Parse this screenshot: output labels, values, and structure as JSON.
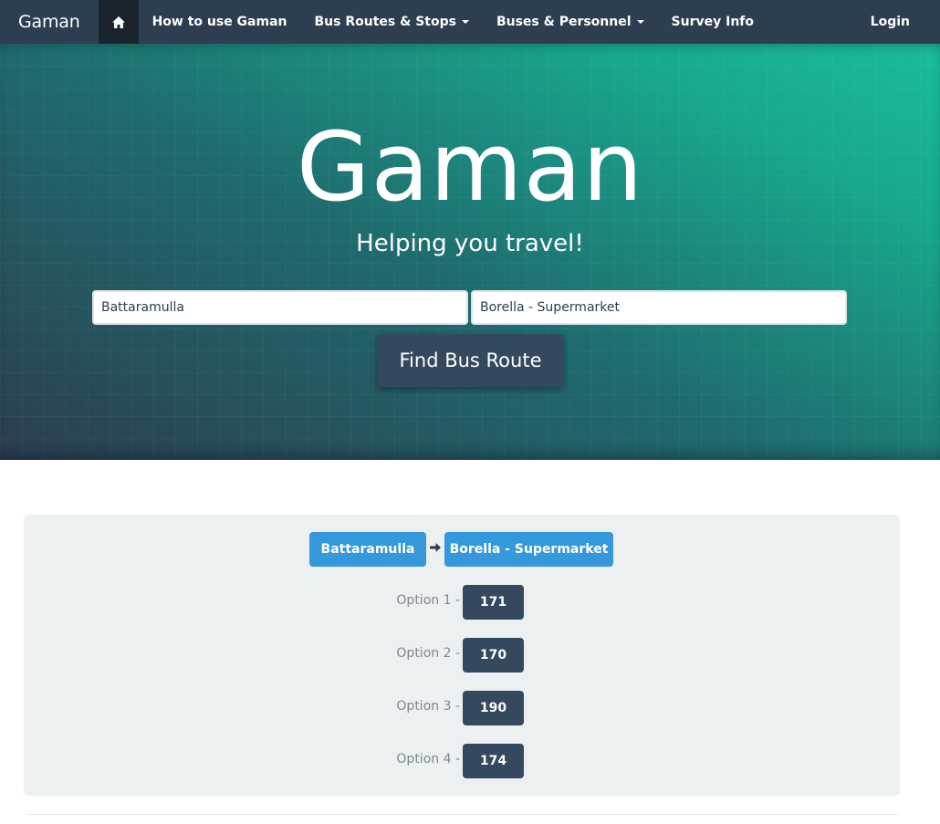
{
  "navbar": {
    "brand": "Gaman",
    "home_icon": "home-icon",
    "items": [
      {
        "label": "How to use Gaman",
        "dropdown": false
      },
      {
        "label": "Bus Routes & Stops",
        "dropdown": true
      },
      {
        "label": "Buses & Personnel",
        "dropdown": true
      },
      {
        "label": "Survey Info",
        "dropdown": false
      }
    ],
    "login": "Login"
  },
  "hero": {
    "title": "Gaman",
    "subtitle": "Helping you travel!",
    "from_value": "Battaramulla",
    "to_value": "Borella - Supermarket",
    "find_button": "Find Bus Route"
  },
  "results": {
    "from": "Battaramulla",
    "to": "Borella - Supermarket",
    "arrow_icon": "arrow-right-icon",
    "options": [
      {
        "label": "Option 1 -",
        "route": "171"
      },
      {
        "label": "Option 2 -",
        "route": "170"
      },
      {
        "label": "Option 3 -",
        "route": "190"
      },
      {
        "label": "Option 4 -",
        "route": "174"
      }
    ]
  },
  "colors": {
    "navbar": "#2c3e50",
    "nav_active": "#1a242f",
    "accent_teal": "#1abc9c",
    "primary_blue": "#3498db",
    "dark_button": "#34495e",
    "panel_bg": "#ecf0f1"
  }
}
